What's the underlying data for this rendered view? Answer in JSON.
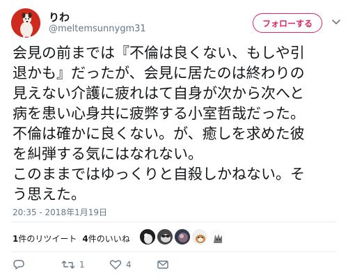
{
  "user": {
    "display_name": "りわ",
    "handle": "@meltemsunnygm31"
  },
  "follow_button": {
    "label": "フォローする"
  },
  "tweet": {
    "lines": [
      "会見の前までは『不倫は良くない、もしや引",
      "退かも』だったが、会見に居たのは終わりの",
      "見えない介護に疲れはて自身が次から次へと",
      "病を患い心身共に疲弊する小室哲哉だった。",
      "不倫は確かに良くない。が、癒しを求めた彼",
      "を糾弾する気にはなれない。",
      "このままではゆっくりと自殺しかねない。そ",
      "う思えた。"
    ],
    "timestamp": "20:35 - 2018年1月19日"
  },
  "stats": {
    "retweet_count": "1",
    "retweet_label": "件のリツイート",
    "like_count": "4",
    "like_label": "件のいいね"
  },
  "actions": {
    "retweet_count": "1",
    "like_count": "4"
  },
  "colors": {
    "accent": "#e0245e",
    "text": "#14171a",
    "secondary": "#657786",
    "divider": "#e6ecf0",
    "avatar_bg": "#cf2a1e"
  },
  "icons": [
    "avatar",
    "chevron-down-icon",
    "reply-icon",
    "retweet-icon",
    "like-icon",
    "dm-icon"
  ]
}
